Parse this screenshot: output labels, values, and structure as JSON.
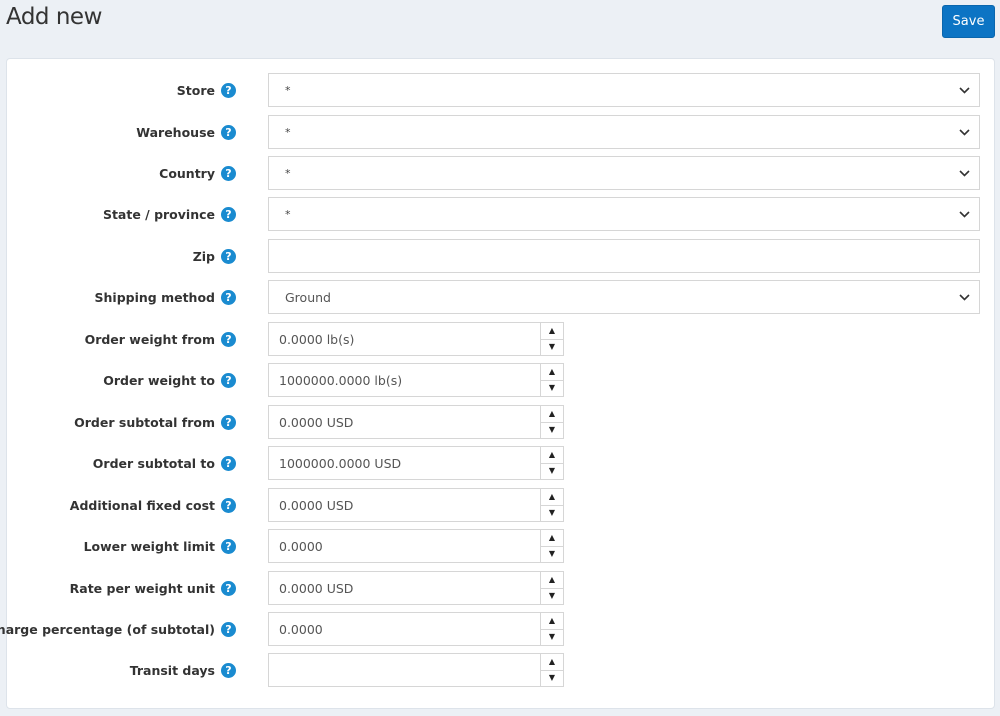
{
  "header": {
    "title": "Add new",
    "save_label": "Save"
  },
  "icons": {
    "help": "?",
    "chevron": "chevron-down-icon",
    "spin_up": "▲",
    "spin_down": "▼"
  },
  "colors": {
    "accent": "#0c74c4",
    "help_icon": "#1a8bd0",
    "background": "#ecf0f5"
  },
  "form": {
    "store": {
      "label": "Store",
      "value": "*"
    },
    "warehouse": {
      "label": "Warehouse",
      "value": "*"
    },
    "country": {
      "label": "Country",
      "value": "*"
    },
    "state": {
      "label": "State / province",
      "value": "*"
    },
    "zip": {
      "label": "Zip",
      "value": ""
    },
    "shipping_method": {
      "label": "Shipping method",
      "value": "Ground"
    },
    "order_weight_from": {
      "label": "Order weight from",
      "value": "0.0000 lb(s)"
    },
    "order_weight_to": {
      "label": "Order weight to",
      "value": "1000000.0000 lb(s)"
    },
    "order_subtotal_from": {
      "label": "Order subtotal from",
      "value": "0.0000 USD"
    },
    "order_subtotal_to": {
      "label": "Order subtotal to",
      "value": "1000000.0000 USD"
    },
    "additional_fixed_cost": {
      "label": "Additional fixed cost",
      "value": "0.0000 USD"
    },
    "lower_weight_limit": {
      "label": "Lower weight limit",
      "value": "0.0000"
    },
    "rate_per_weight_unit": {
      "label": "Rate per weight unit",
      "value": "0.0000 USD"
    },
    "charge_percentage": {
      "label": "Charge percentage (of subtotal)",
      "value": "0.0000"
    },
    "transit_days": {
      "label": "Transit days",
      "value": ""
    }
  }
}
